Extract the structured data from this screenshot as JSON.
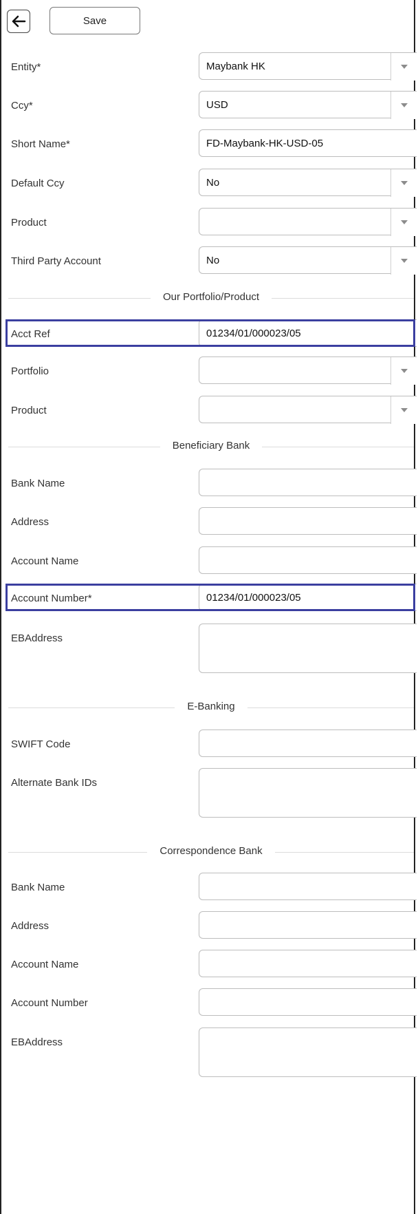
{
  "toolbar": {
    "back_icon": "arrow-left-icon",
    "save_label": "Save"
  },
  "general": {
    "entity": {
      "label": "Entity*",
      "value": "Maybank HK"
    },
    "ccy": {
      "label": "Ccy*",
      "value": "USD"
    },
    "short_name": {
      "label": "Short Name*",
      "value": "FD-Maybank-HK-USD-05"
    },
    "default_ccy": {
      "label": "Default Ccy",
      "value": "No"
    },
    "product": {
      "label": "Product",
      "value": ""
    },
    "third_party": {
      "label": "Third Party Account",
      "value": "No"
    }
  },
  "portfolio_section": {
    "title": "Our Portfolio/Product",
    "acct_ref": {
      "label": "Acct Ref",
      "value": "01234/01/000023/05"
    },
    "portfolio": {
      "label": "Portfolio",
      "value": ""
    },
    "product": {
      "label": "Product",
      "value": ""
    }
  },
  "beneficiary_section": {
    "title": "Beneficiary Bank",
    "bank_name": {
      "label": "Bank Name",
      "value": ""
    },
    "address": {
      "label": "Address",
      "value": ""
    },
    "account_name": {
      "label": "Account Name",
      "value": ""
    },
    "account_number": {
      "label": "Account Number*",
      "value": "01234/01/000023/05"
    },
    "ebaddress": {
      "label": "EBAddress",
      "value": ""
    }
  },
  "ebanking_section": {
    "title": "E-Banking",
    "swift": {
      "label": "SWIFT Code",
      "value": ""
    },
    "alt_ids": {
      "label": "Alternate Bank IDs",
      "value": ""
    }
  },
  "correspondence_section": {
    "title": "Correspondence Bank",
    "bank_name": {
      "label": "Bank Name",
      "value": ""
    },
    "address": {
      "label": "Address",
      "value": ""
    },
    "account_name": {
      "label": "Account Name",
      "value": ""
    },
    "account_number": {
      "label": "Account Number",
      "value": ""
    },
    "ebaddress": {
      "label": "EBAddress",
      "value": ""
    }
  },
  "colors": {
    "highlight": "#3b3fa0",
    "border": "#bdbdbd"
  }
}
